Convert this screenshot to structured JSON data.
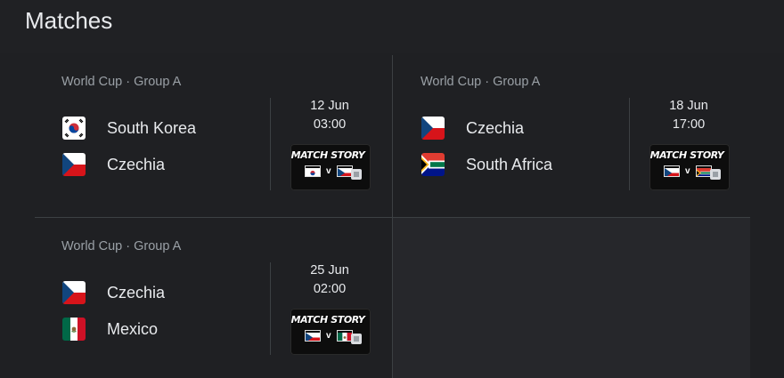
{
  "title": "Matches",
  "matches": [
    {
      "competition": "World Cup · Group A",
      "home": {
        "name": "South Korea",
        "flag": "south-korea-flag"
      },
      "away": {
        "name": "Czechia",
        "flag": "czechia-flag"
      },
      "date": "12 Jun",
      "time": "03:00",
      "story_label": "MATCH STORY",
      "story_v": "v"
    },
    {
      "competition": "World Cup · Group A",
      "home": {
        "name": "Czechia",
        "flag": "czechia-flag"
      },
      "away": {
        "name": "South Africa",
        "flag": "south-africa-flag"
      },
      "date": "18 Jun",
      "time": "17:00",
      "story_label": "MATCH STORY",
      "story_v": "v"
    },
    {
      "competition": "World Cup · Group A",
      "home": {
        "name": "Czechia",
        "flag": "czechia-flag"
      },
      "away": {
        "name": "Mexico",
        "flag": "mexico-flag"
      },
      "date": "25 Jun",
      "time": "02:00",
      "story_label": "MATCH STORY",
      "story_v": "v"
    }
  ],
  "colors": {
    "background": "#202124",
    "text": "#e8eaed",
    "muted": "#9aa0a6",
    "divider": "#3c4043"
  }
}
